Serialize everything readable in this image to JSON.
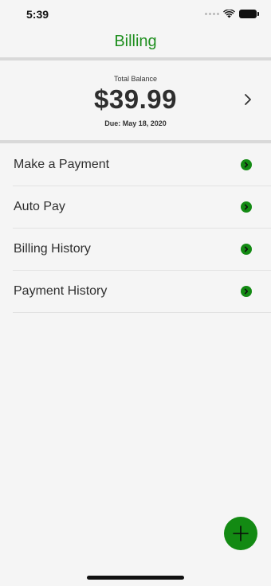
{
  "status_bar": {
    "time": "5:39"
  },
  "header": {
    "title": "Billing"
  },
  "balance": {
    "label": "Total Balance",
    "amount": "$39.99",
    "due": "Due: May 18, 2020"
  },
  "menu": {
    "items": [
      {
        "label": "Make a Payment"
      },
      {
        "label": "Auto Pay"
      },
      {
        "label": "Billing History"
      },
      {
        "label": "Payment History"
      }
    ]
  },
  "icons": {
    "chevron": "chevron-right-icon",
    "arrow": "arrow-circle-right-icon",
    "fab": "plus-icon"
  },
  "colors": {
    "accent": "#1f8f1f",
    "fab": "#138a13",
    "background": "#f5f5f5"
  }
}
